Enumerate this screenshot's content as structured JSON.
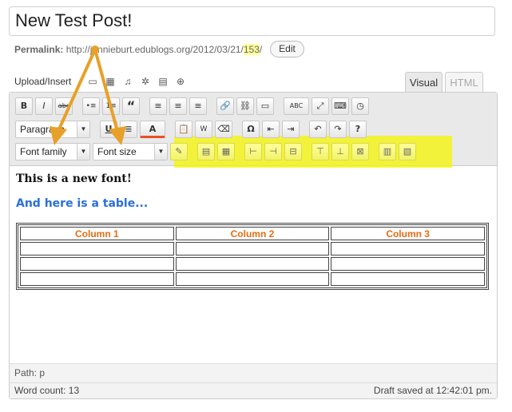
{
  "post": {
    "title": "New Test Post!"
  },
  "permalink": {
    "label": "Permalink:",
    "url_prefix": "http://jennieburt.edublogs.org/2012/03/21/",
    "url_slug": "153",
    "url_suffix": "/",
    "edit_label": "Edit"
  },
  "media": {
    "upload_label": "Upload/Insert",
    "icons": [
      "image-icon",
      "gallery-icon",
      "audio-icon",
      "media-icon",
      "document-icon",
      "globe-icon"
    ]
  },
  "tabs": {
    "visual": "Visual",
    "html": "HTML"
  },
  "toolbar": {
    "row1": [
      "B",
      "I",
      "abc",
      "•≡",
      "1≡",
      "“",
      "≡",
      "≡",
      "≡",
      "🔗",
      "⛓",
      "▭",
      "ABC",
      "⤢",
      "⌨",
      "◷"
    ],
    "format_select": "Paragraph",
    "row2": [
      "U",
      "≣",
      "A",
      "📋",
      "W",
      "⌫",
      "Ω",
      "⇤",
      "⇥",
      "↶",
      "↷",
      "?"
    ],
    "font_family": "Font family",
    "font_size": "Font size",
    "table_buttons": [
      "✎",
      "▤",
      "▦",
      "⊢",
      "⊣",
      "⊟",
      "⊤",
      "⊥",
      "⊠",
      "▥",
      "▧"
    ],
    "highlight_color": "#f4f400"
  },
  "content": {
    "line1": "This is a new font!",
    "line2": "And here is a table...",
    "table": {
      "headers": [
        "Column 1",
        "Column 2",
        "Column 3"
      ],
      "rows": [
        [
          "",
          "",
          ""
        ],
        [
          "",
          "",
          ""
        ],
        [
          "",
          "",
          ""
        ]
      ]
    }
  },
  "footer": {
    "path": "Path: p",
    "word_count": "Word count: 13",
    "draft_status": "Draft saved at 12:42:01 pm."
  },
  "colors": {
    "accent_arrow": "#e8a028",
    "heading_blue": "#2a6fd8",
    "table_header": "#e86a10"
  }
}
